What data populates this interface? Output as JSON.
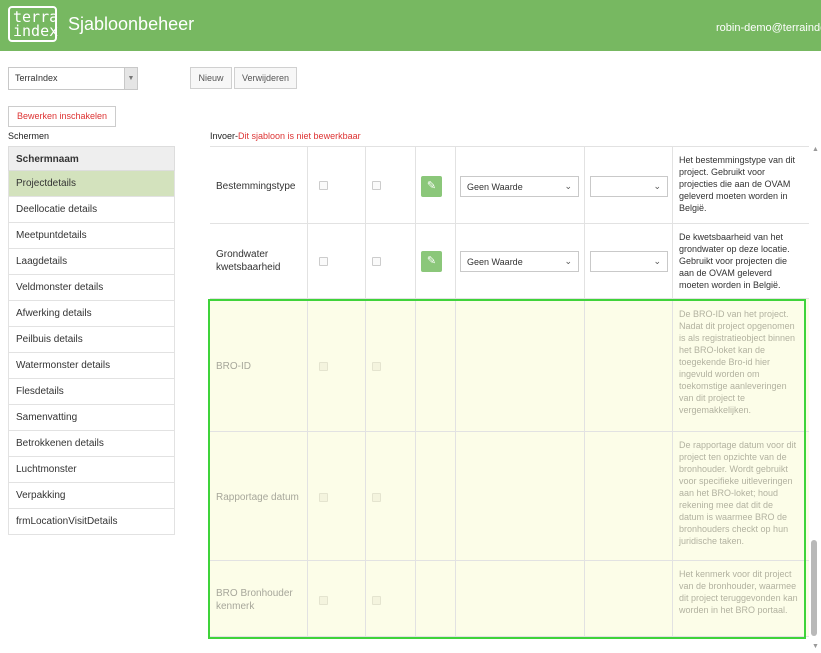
{
  "header": {
    "logo_line1": "terra",
    "logo_line2": "index",
    "title": "Sjabloonbeheer",
    "user": "robin-demo@terrainde"
  },
  "toolbar": {
    "select_value": "TerraIndex",
    "new_label": "Nieuw",
    "delete_label": "Verwijderen",
    "edit_toggle_label": "Bewerken inschakelen"
  },
  "screens": {
    "section_label": "Schermen",
    "column_header": "Schermnaam",
    "items": [
      "Projectdetails",
      "Deellocatie details",
      "Meetpuntdetails",
      "Laagdetails",
      "Veldmonster details",
      "Afwerking details",
      "Peilbuis details",
      "Watermonster details",
      "Flesdetails",
      "Samenvatting",
      "Betrokkenen details",
      "Luchtmonster",
      "Verpakking",
      "frmLocationVisitDetails"
    ],
    "active_index": 0
  },
  "invoer": {
    "prefix": "Invoer-",
    "warning": "Dit sjabloon is niet bewerkbaar"
  },
  "fields": [
    {
      "name": "Bestemmingstype",
      "dropdown_value": "Geen Waarde",
      "description": "Het bestemmingstype van dit project. Gebruikt voor projecties die aan de OVAM geleverd moeten worden in België.",
      "disabled": false
    },
    {
      "name": "Grondwater kwetsbaarheid",
      "dropdown_value": "Geen Waarde",
      "description": "De kwetsbaarheid van het grondwater op deze locatie. Gebruikt voor projecten die aan de OVAM geleverd moeten worden in België.",
      "disabled": false
    },
    {
      "name": "BRO-ID",
      "description": "De BRO-ID van het project. Nadat dit project opgenomen is als registratieobject binnen het BRO-loket kan de toegekende Bro-id hier ingevuld worden om toekomstige aanleveringen van dit project te vergemakkelijken.",
      "disabled": true
    },
    {
      "name": "Rapportage datum",
      "description": "De rapportage datum voor dit project ten opzichte van de bronhouder. Wordt gebruikt voor specifieke uitleveringen aan het BRO-loket; houd rekening mee dat dit de datum is waarmee BRO de bronhouders checkt op hun juridische taken.",
      "disabled": true
    },
    {
      "name": "BRO Bronhouder kenmerk",
      "description": "Het kenmerk voor dit project van de bronhouder, waarmee dit project teruggevonden kan worden in het BRO portaal.",
      "disabled": true
    }
  ],
  "icons": {
    "edit": "pencil-icon",
    "dropdown": "chevron-down-icon"
  },
  "colors": {
    "header_bg": "#77b861",
    "active_screen_bg": "#d3e2bd",
    "edit_button": "#8bc77a",
    "highlight_border": "#3fd33a",
    "disabled_row_bg": "#fcfde8",
    "warning_text": "#d33333"
  }
}
